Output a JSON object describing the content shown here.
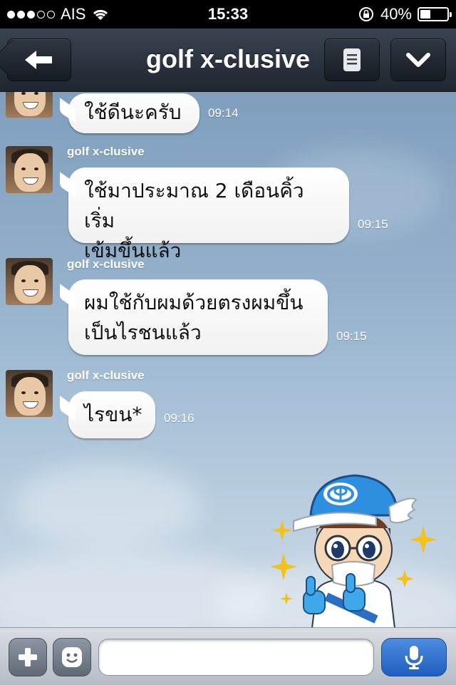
{
  "status_bar": {
    "carrier": "AIS",
    "time": "15:33",
    "battery": "40%",
    "battery_level": 0.4,
    "signal_bars": 3,
    "signal_total": 5
  },
  "nav": {
    "title": "golf x-clusive",
    "back_icon": "back-arrow-icon",
    "menu_icon": "list-icon",
    "dropdown_icon": "chevron-down-icon"
  },
  "messages": [
    {
      "sender": "",
      "text": "ใช้ดีนะครับ",
      "time": "09:14"
    },
    {
      "sender": "golf x-clusive",
      "text_lines": [
        "ใช้มาประมาณ 2 เดือนคิ้วเริ่ม",
        "เข้มขึ้นแล้ว"
      ],
      "time": "09:15"
    },
    {
      "sender": "golf x-clusive",
      "text_lines": [
        "ผมใช้กับผมด้วยตรงผมขึ้น",
        "เป็นไรชนแล้ว"
      ],
      "time": "09:15"
    },
    {
      "sender": "golf x-clusive",
      "text": "ไรขน*",
      "time": "09:16"
    }
  ],
  "input": {
    "placeholder": "",
    "plus_icon": "plus-icon",
    "sticker_icon": "smiley-icon",
    "mic_icon": "microphone-icon"
  },
  "colors": {
    "nav_bg": "#2b333e",
    "accent_mic": "#2f74d0",
    "chat_sky": "#93b0cb"
  }
}
